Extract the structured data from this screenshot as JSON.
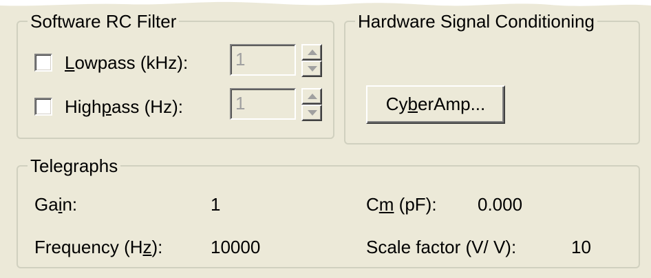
{
  "software_filter": {
    "title": "Software RC Filter",
    "lowpass": {
      "label_pre": "",
      "label_mnemonic": "L",
      "label_post": "owpass (kHz):",
      "checked": false,
      "value": "1"
    },
    "highpass": {
      "label_pre": "High",
      "label_mnemonic": "p",
      "label_post": "ass (Hz):",
      "checked": false,
      "value": "1"
    }
  },
  "hardware": {
    "title": "Hardware Signal Conditioning",
    "button_pre": "Cy",
    "button_mnemonic": "b",
    "button_post": "erAmp..."
  },
  "telegraphs": {
    "title": "Telegraphs",
    "gain_label_pre": "Ga",
    "gain_label_mnemonic": "i",
    "gain_label_post": "n:",
    "gain_value": "1",
    "freq_label_pre": "Frequency (H",
    "freq_label_mnemonic": "z",
    "freq_label_post": "):",
    "freq_value": "10000",
    "cm_label_pre": "C",
    "cm_label_mnemonic": "m",
    "cm_label_post": " (pF):",
    "cm_value": "0.000",
    "scale_label": "Scale factor (V/ V):",
    "scale_value": "10"
  },
  "icons": {
    "spin_up": "up-arrow-icon",
    "spin_down": "down-arrow-icon"
  }
}
